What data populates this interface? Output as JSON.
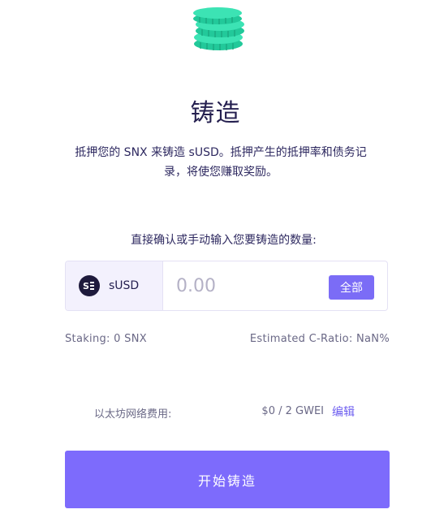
{
  "header": {
    "icon": "coins-icon",
    "title": "铸造",
    "description": "抵押您的 SNX 来铸造 sUSD。抵押产生的抵押率和债务记录，将使您赚取奖励。"
  },
  "form": {
    "instruction": "直接确认或手动输入您要铸造的数量:",
    "currency": {
      "icon": "susd-icon",
      "label": "sUSD"
    },
    "amount_input": {
      "value": "",
      "placeholder": "0.00"
    },
    "max_label": "全部"
  },
  "stats": {
    "staking": "Staking:  0 SNX",
    "c_ratio": "Estimated C-Ratio:  NaN%"
  },
  "gas": {
    "label": "以太坊网络费用:",
    "value": "$0 / 2 GWEI",
    "edit_label": "编辑"
  },
  "submit_label": "开始铸造",
  "colors": {
    "accent": "#7d6bfc",
    "coin": "#2fd8ab",
    "title_text": "#241f4f",
    "muted_text": "#6a6886"
  }
}
